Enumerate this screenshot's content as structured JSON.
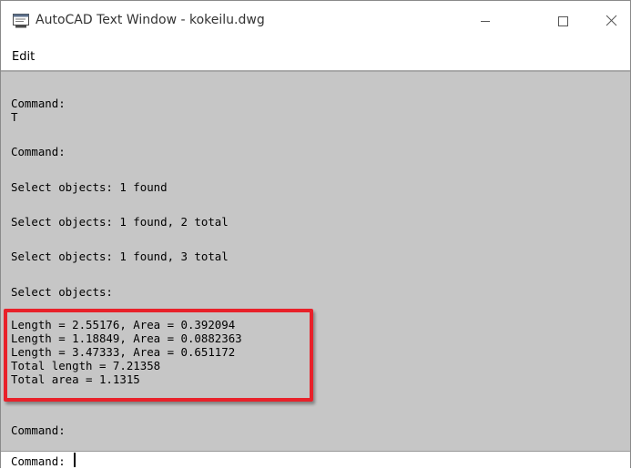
{
  "window": {
    "title": "AutoCAD Text Window - kokeilu.dwg",
    "icons": {
      "app": "autocad-text-window-icon",
      "minimize": "minimize-icon",
      "maximize": "maximize-icon",
      "close": "close-icon"
    }
  },
  "menu": {
    "edit": "Edit"
  },
  "console": {
    "lines": [
      "Command:",
      "T",
      "Command:",
      "Select objects: 1 found",
      "Select objects: 1 found, 2 total",
      "Select objects: 1 found, 3 total",
      "Select objects:",
      "Length = 2.55176, Area = 0.392094",
      "Length = 1.18849, Area = 0.0882363",
      "Length = 3.47333, Area = 0.651172",
      "Total length = 7.21358",
      "Total area = 1.1315",
      "Command:"
    ],
    "highlight_color": "#e8212a"
  },
  "command_line": {
    "prompt": "Command:",
    "value": ""
  }
}
